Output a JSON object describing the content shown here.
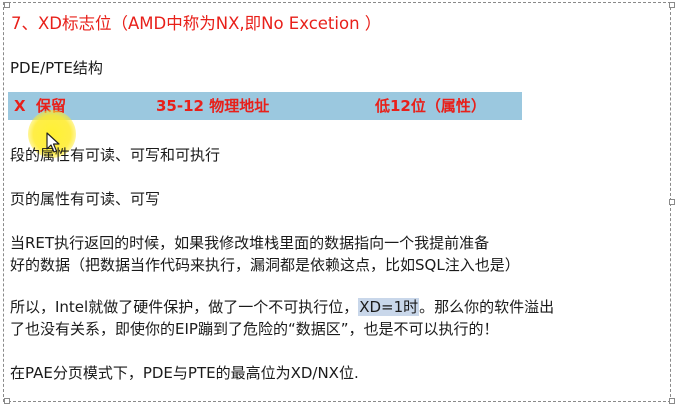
{
  "slide": {
    "title": "7、XD标志位（AMD中称为NX,即No Excetion ）",
    "subtitle": "PDE/PTE结构",
    "bar": {
      "x": "X",
      "reserved": "保留",
      "physical": "35-12  物理地址",
      "low": "低12位（属性）"
    },
    "seg_attr": "段的属性有可读、可写和可执行",
    "page_attr": "页的属性有可读、可写",
    "ret_line1": "当RET执行返回的时候，如果我修改堆栈里面的数据指向一个我提前准备",
    "ret_line2": "好的数据（把数据当作代码来执行，漏洞都是依赖这点，比如SQL注入也是）",
    "intel_line1_pre": "所以，Intel就做了硬件保护，做了一个不可执行位，",
    "intel_line1_hl": "XD=1时",
    "intel_line1_post": "。那么你的软件溢出",
    "intel_line2": "了也没有关系，即使你的EIP蹦到了危险的“数据区”，也是不可以执行的！",
    "pae_line": "在PAE分页模式下，PDE与PTE的最高位为XD/NX位."
  },
  "colors": {
    "title": "#e8201a",
    "bar_bg": "#9bc8df",
    "bar_text": "#e8201a",
    "highlight": "#c9d7ea",
    "cursor": "#ffeb28"
  },
  "icons": {
    "cursor": "mouse-pointer-icon"
  }
}
